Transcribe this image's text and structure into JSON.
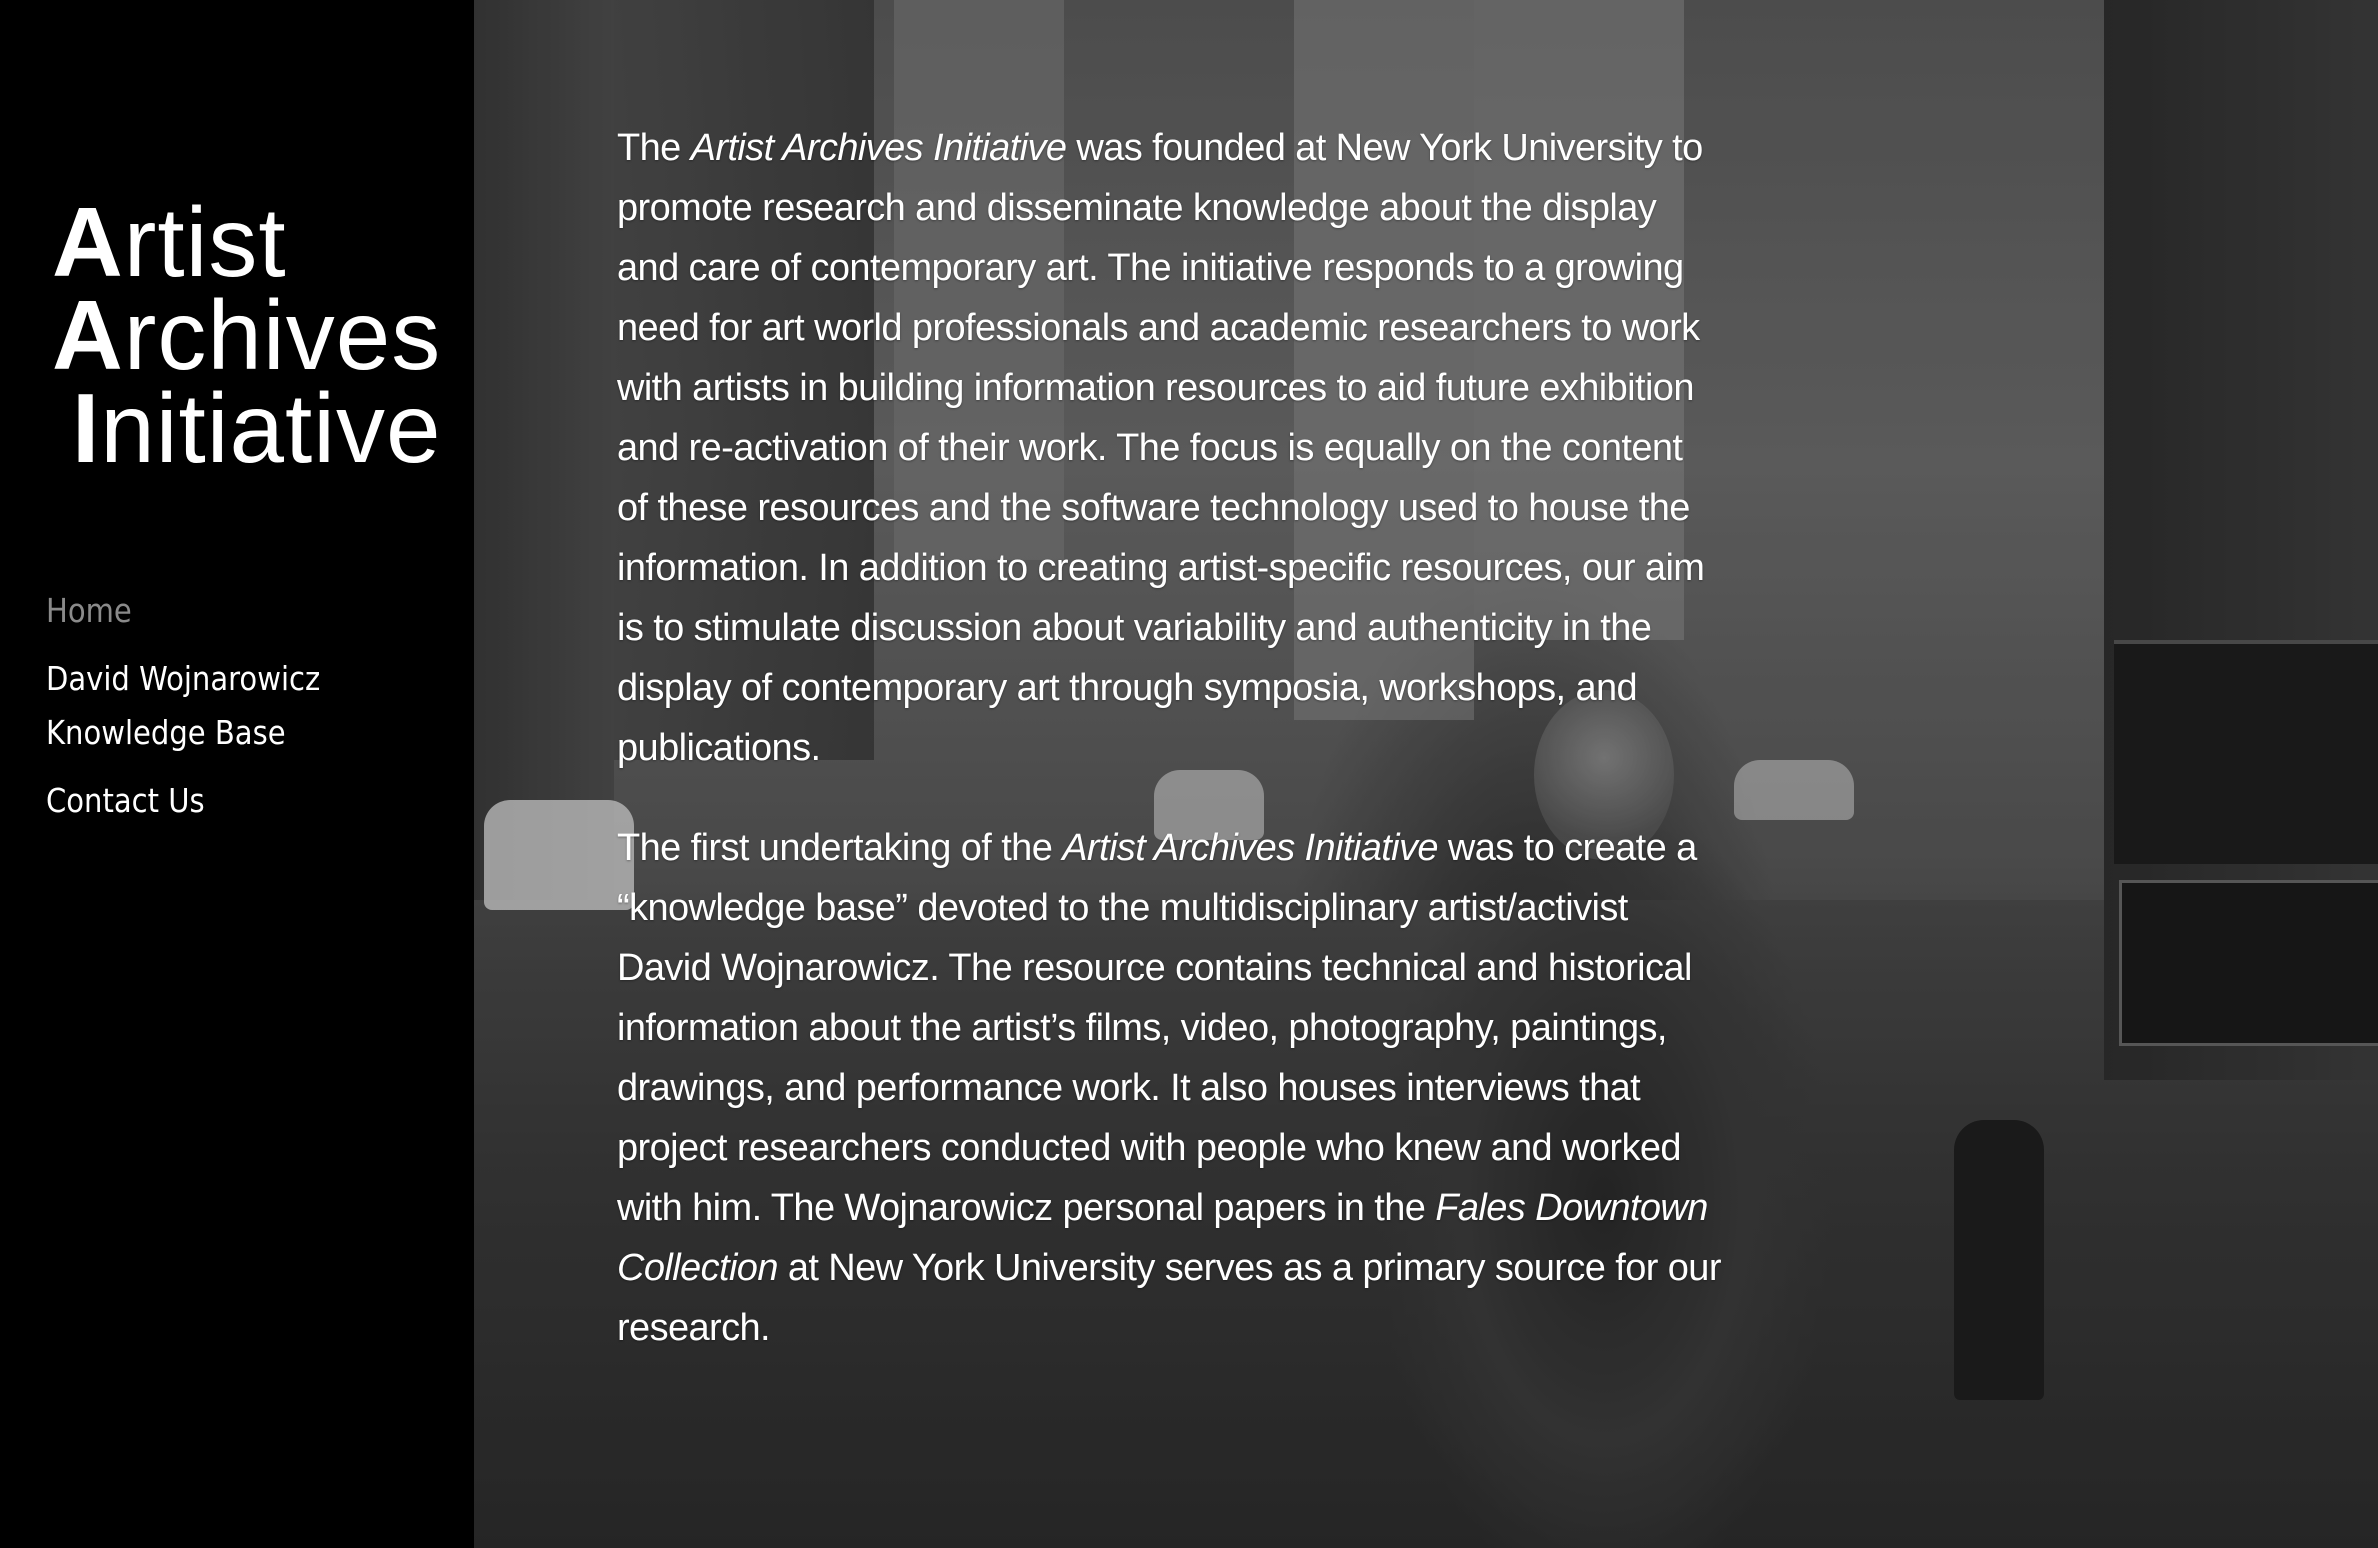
{
  "logo": {
    "line1_initial": "A",
    "line1_rest": "rtist",
    "line2_initial": "A",
    "line2_rest": "rchives",
    "line3_initial": "I",
    "line3_rest": "nitiative"
  },
  "nav": {
    "home": "Home",
    "kb_line1": "David Wojnarowicz",
    "kb_line2": "Knowledge Base",
    "contact": "Contact Us"
  },
  "hero": {
    "background": "black-and-white street photograph of Times Square with a man in a denim jacket"
  },
  "content": {
    "p1": [
      {
        "a": "The ",
        "i": "Artist Archives Initiative",
        "b": " was founded at New York University to"
      },
      {
        "a": "promote research and disseminate knowledge about the display"
      },
      {
        "a": "and care of contemporary art. The initiative responds to a growing"
      },
      {
        "a": "need for art world professionals and academic researchers to work"
      },
      {
        "a": "with artists in building information resources to aid future exhibition"
      },
      {
        "a": "and re-activation of their work. The focus is equally on the content"
      },
      {
        "a": "of these resources and the software technology used to house the"
      },
      {
        "a": "information. In addition to creating artist-specific resources, our aim"
      },
      {
        "a": "is to stimulate discussion about variability and authenticity in the"
      },
      {
        "a": "display of contemporary art through symposia, workshops, and"
      },
      {
        "a": "publications."
      }
    ],
    "p2": [
      {
        "a": "The first undertaking of the ",
        "i": "Artist Archives Initiative",
        "b": " was to create a"
      },
      {
        "a": "“knowledge base” devoted to the multidisciplinary artist/activist"
      },
      {
        "a": "David Wojnarowicz. The resource contains technical and historical"
      },
      {
        "a": "information about the artist’s films, video, photography, paintings,"
      },
      {
        "a": "drawings, and performance work. It also houses interviews that"
      },
      {
        "a": "project researchers conducted with people who knew and worked"
      },
      {
        "a": "with him. The Wojnarowicz personal papers in the ",
        "i": "Fales Downtown"
      },
      {
        "a": "",
        "i": "Collection",
        "b": " at New York University serves as a primary source for our"
      },
      {
        "a": "research."
      }
    ]
  }
}
